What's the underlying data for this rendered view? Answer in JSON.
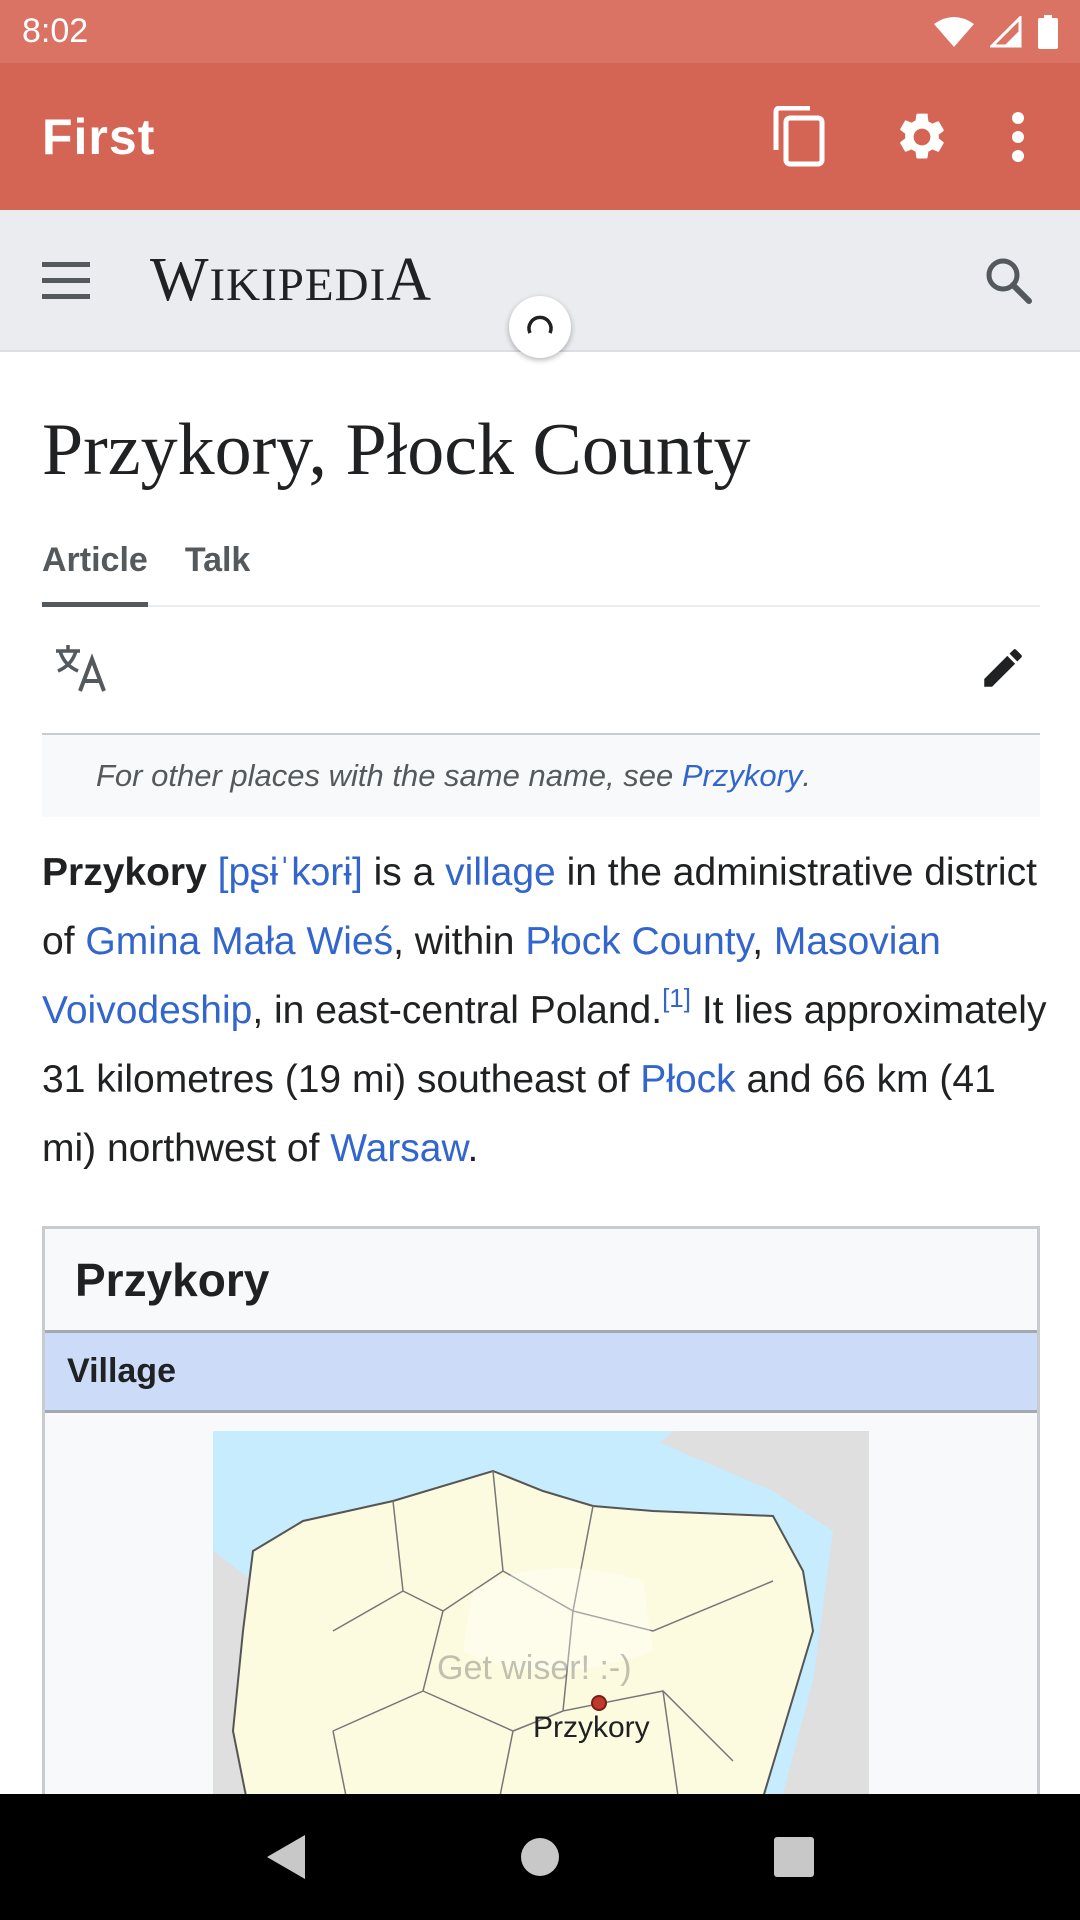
{
  "status_bar": {
    "time": "8:02"
  },
  "app_bar": {
    "title": "First"
  },
  "wiki_header": {
    "wordmark_initial_1": "W",
    "wordmark_rest_1": "IKIPEDI",
    "wordmark_initial_2": "A"
  },
  "article": {
    "title": "Przykory, Płock County",
    "tabs": [
      {
        "label": "Article"
      },
      {
        "label": "Talk"
      }
    ],
    "hatnote": {
      "prefix": "For other places with the same name, see ",
      "link": "Przykory",
      "suffix": "."
    },
    "lead": {
      "name": "Przykory",
      "ipa": "[pʂɨˈkɔrɨ]",
      "t1": " is a ",
      "village": "village",
      "t2": " in the administrative district of ",
      "gmina": "Gmina Mała Wieś",
      "t3": ", within ",
      "county": "Płock County",
      "t4": ", ",
      "voivodeship": "Masovian Voivodeship",
      "t5": ", in east-central Poland.",
      "ref": "[1]",
      "t6": " It lies approximately 31 kilometres (19 mi) southeast of ",
      "plock": "Płock",
      "t7": " and 66 km (41 mi) northwest of ",
      "warsaw": "Warsaw",
      "t8": "."
    }
  },
  "infobox": {
    "title": "Przykory",
    "type": "Village",
    "map": {
      "watermark": "Get wiser! :-)",
      "marker_label": "Przykory"
    }
  },
  "colors": {
    "status_bar": "#db7364",
    "app_bar": "#d46554",
    "link": "#3366cc",
    "infobox_header": "#ccdcf8"
  }
}
